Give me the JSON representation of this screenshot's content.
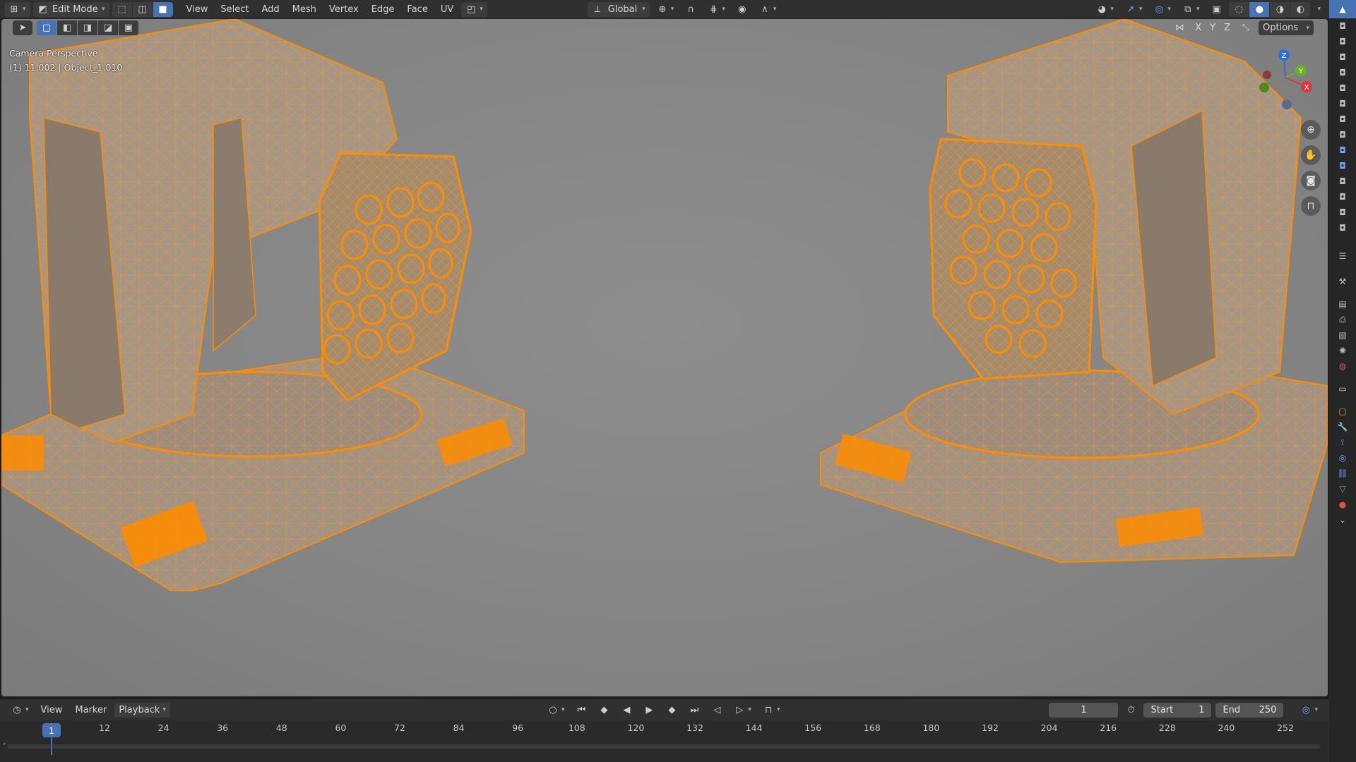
{
  "topbar": {
    "mode": "Edit Mode",
    "menus": [
      "View",
      "Select",
      "Add",
      "Mesh",
      "Vertex",
      "Edge",
      "Face",
      "UV"
    ],
    "orientation": "Global"
  },
  "viewport": {
    "camera_label": "Camera Perspective",
    "object_label": "(1) 11.002 | Object_1.010",
    "options_label": "Options",
    "axes": {
      "x": "X",
      "y": "Y",
      "z": "Z"
    },
    "gizmo_labels": {
      "z": "Z",
      "y": "Y",
      "x": "X"
    },
    "mesh_color": "#ff8c00"
  },
  "timeline": {
    "menus": [
      "View",
      "Marker"
    ],
    "playback_label": "Playback",
    "current_frame": "1",
    "start_label": "Start",
    "start_value": "1",
    "end_label": "End",
    "end_value": "250",
    "playhead_label": "1",
    "ticks": [
      "12",
      "24",
      "36",
      "48",
      "60",
      "72",
      "84",
      "96",
      "108",
      "120",
      "132",
      "144",
      "156",
      "168",
      "180",
      "192",
      "204",
      "216",
      "228",
      "240",
      "252"
    ]
  },
  "colors": {
    "accent": "#4772b3",
    "panel": "#303030",
    "selection": "#ff8c00"
  }
}
